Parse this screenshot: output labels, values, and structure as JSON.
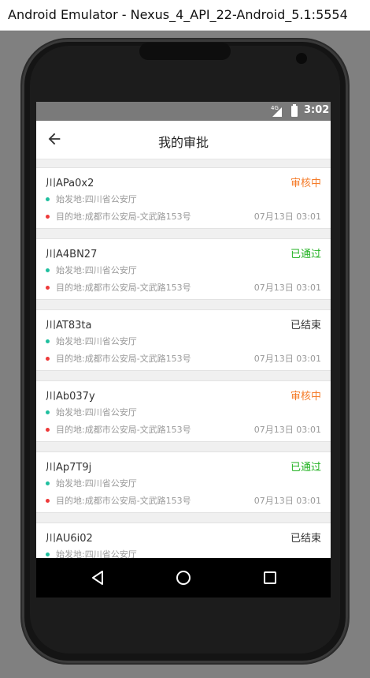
{
  "window": {
    "title": "Android Emulator - Nexus_4_API_22-Android_5.1:5554"
  },
  "statusbar": {
    "network": "4G",
    "time": "3:02"
  },
  "appbar": {
    "title": "我的审批",
    "back_icon": "arrow-back-icon"
  },
  "colors": {
    "pending": "#f57c2a",
    "approved": "#22b222",
    "ended": "#333333",
    "start_dot": "#1fbf9f",
    "end_dot": "#ee3a3a"
  },
  "items": [
    {
      "plate": "川APa0x2",
      "status": "审核中",
      "status_kind": "pending",
      "origin": "始发地:四川省公安厅",
      "destination": "目的地:成都市公安局-文武路153号",
      "time": "07月13日 03:01"
    },
    {
      "plate": "川A4BN27",
      "status": "已通过",
      "status_kind": "approved",
      "origin": "始发地:四川省公安厅",
      "destination": "目的地:成都市公安局-文武路153号",
      "time": "07月13日 03:01"
    },
    {
      "plate": "川AT83ta",
      "status": "已结束",
      "status_kind": "ended",
      "origin": "始发地:四川省公安厅",
      "destination": "目的地:成都市公安局-文武路153号",
      "time": "07月13日 03:01"
    },
    {
      "plate": "川Ab037y",
      "status": "审核中",
      "status_kind": "pending",
      "origin": "始发地:四川省公安厅",
      "destination": "目的地:成都市公安局-文武路153号",
      "time": "07月13日 03:01"
    },
    {
      "plate": "川Ap7T9j",
      "status": "已通过",
      "status_kind": "approved",
      "origin": "始发地:四川省公安厅",
      "destination": "目的地:成都市公安局-文武路153号",
      "time": "07月13日 03:01"
    },
    {
      "plate": "川AU6i02",
      "status": "已结束",
      "status_kind": "ended",
      "origin": "始发地:四川省公安厅",
      "destination": "",
      "time": ""
    }
  ],
  "navbar": {
    "back": "nav-back-icon",
    "home": "nav-home-icon",
    "recents": "nav-recents-icon"
  }
}
